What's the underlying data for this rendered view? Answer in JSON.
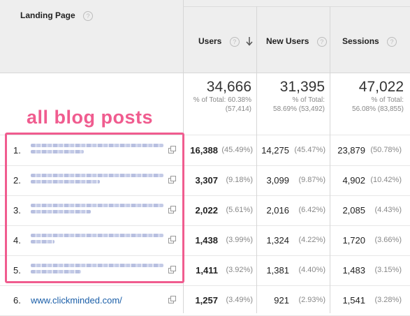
{
  "header": {
    "landing_page": "Landing Page",
    "users": "Users",
    "new_users": "New Users",
    "sessions": "Sessions",
    "help": "?"
  },
  "totals": {
    "users": {
      "value": "34,666",
      "pct": "% of Total: 60.38%",
      "total": "(57,414)"
    },
    "new_users": {
      "value": "31,395",
      "pct": "% of Total:",
      "pct2": "58.69% (53,492)"
    },
    "sessions": {
      "value": "47,022",
      "pct": "% of Total:",
      "pct2": "56.08% (83,855)"
    }
  },
  "annotation": "all blog posts",
  "rows": [
    {
      "idx": "1.",
      "page": "",
      "users": "16,388",
      "users_pct": "(45.49%)",
      "new_users": "14,275",
      "new_pct": "(45.47%)",
      "sessions": "23,879",
      "sess_pct": "(50.78%)"
    },
    {
      "idx": "2.",
      "page": "",
      "users": "3,307",
      "users_pct": "(9.18%)",
      "new_users": "3,099",
      "new_pct": "(9.87%)",
      "sessions": "4,902",
      "sess_pct": "(10.42%)"
    },
    {
      "idx": "3.",
      "page": "",
      "users": "2,022",
      "users_pct": "(5.61%)",
      "new_users": "2,016",
      "new_pct": "(6.42%)",
      "sessions": "2,085",
      "sess_pct": "(4.43%)"
    },
    {
      "idx": "4.",
      "page": "",
      "users": "1,438",
      "users_pct": "(3.99%)",
      "new_users": "1,324",
      "new_pct": "(4.22%)",
      "sessions": "1,720",
      "sess_pct": "(3.66%)"
    },
    {
      "idx": "5.",
      "page": "",
      "users": "1,411",
      "users_pct": "(3.92%)",
      "new_users": "1,381",
      "new_pct": "(4.40%)",
      "sessions": "1,483",
      "sess_pct": "(3.15%)"
    },
    {
      "idx": "6.",
      "page": "www.clickminded.com/",
      "users": "1,257",
      "users_pct": "(3.49%)",
      "new_users": "921",
      "new_pct": "(2.93%)",
      "sessions": "1,541",
      "sess_pct": "(3.28%)"
    }
  ],
  "colors": {
    "annotation": "#f05c8f",
    "link": "#1a5ea8",
    "header_bg": "#eeeeee"
  },
  "icons": {
    "external_link": "external-link-icon",
    "sort": "sort-down-arrow-icon",
    "help": "help-icon"
  }
}
